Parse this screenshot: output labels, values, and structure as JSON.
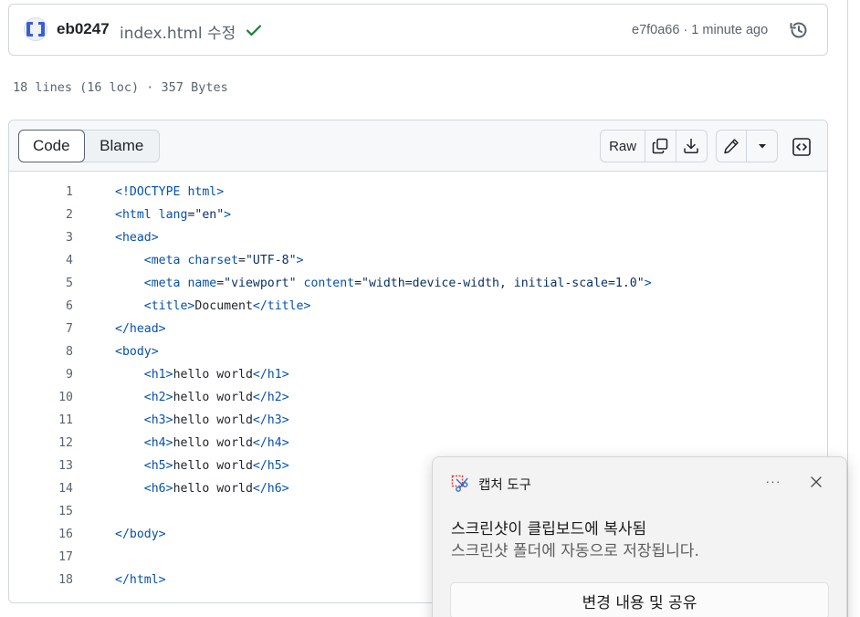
{
  "commit": {
    "author": "eb0247",
    "message": "index.html 수정",
    "status": "success",
    "sha": "e7f0a66",
    "time": "1 minute ago",
    "meta": "e7f0a66 · 1 minute ago"
  },
  "file_info": "18 lines (16 loc) · 357 Bytes",
  "toolbar": {
    "code_tab": "Code",
    "blame_tab": "Blame",
    "raw_label": "Raw",
    "copy_icon": "copy-icon",
    "download_icon": "download-icon",
    "edit_icon": "pencil-icon",
    "dropdown_icon": "triangle-down-icon",
    "symbols_icon": "code-square-icon"
  },
  "code": {
    "line_numbers": [
      "1",
      "2",
      "3",
      "4",
      "5",
      "6",
      "7",
      "8",
      "9",
      "10",
      "11",
      "12",
      "13",
      "14",
      "15",
      "16",
      "17",
      "18"
    ],
    "lines": [
      "<!DOCTYPE html>",
      "<html lang=\"en\">",
      "<head>",
      "    <meta charset=\"UTF-8\">",
      "    <meta name=\"viewport\" content=\"width=device-width, initial-scale=1.0\">",
      "    <title>Document</title>",
      "</head>",
      "<body>",
      "    <h1>hello world</h1>",
      "    <h2>hello world</h2>",
      "    <h3>hello world</h3>",
      "    <h4>hello world</h4>",
      "    <h5>hello world</h5>",
      "    <h6>hello world</h6>",
      "",
      "</body>",
      "",
      "</html>"
    ]
  },
  "toast": {
    "app_name": "캡처 도구",
    "more_label": "···",
    "title": "스크린샷이 클립보드에 복사됨",
    "body": "스크린샷 폴더에 자동으로 저장됩니다.",
    "action_label": "변경 내용 및 공유"
  },
  "colors": {
    "accent_green": "#1a7f37",
    "border": "#d0d7de",
    "muted_text": "#59636e",
    "tag_blue": "#0550ae"
  }
}
